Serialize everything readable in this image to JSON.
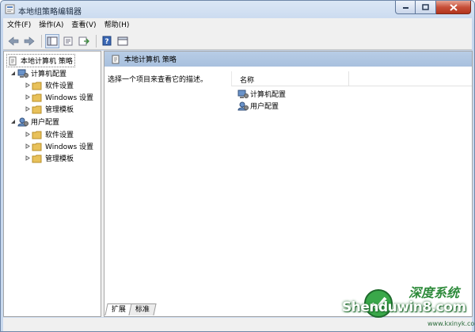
{
  "window": {
    "title": "本地组策略编辑器"
  },
  "menu": [
    "文件(F)",
    "操作(A)",
    "查看(V)",
    "帮助(H)"
  ],
  "tree": {
    "root": "本地计算机 策略",
    "computer": {
      "label": "计算机配置",
      "children": [
        "软件设置",
        "Windows 设置",
        "管理模板"
      ]
    },
    "user": {
      "label": "用户配置",
      "children": [
        "软件设置",
        "Windows 设置",
        "管理模板"
      ]
    }
  },
  "right": {
    "header": "本地计算机 策略",
    "description": "选择一个项目来查看它的描述。",
    "column_name": "名称",
    "items": [
      "计算机配置",
      "用户配置"
    ]
  },
  "tabs": [
    "扩展",
    "标准"
  ],
  "watermark": {
    "text": "Shenduwin8.com",
    "brand": "深度系统",
    "url": "www.kxinyk.com"
  },
  "colors": {
    "header_blue": "#a8c0de",
    "folder": "#e8c15a",
    "close_red": "#c7503a"
  }
}
